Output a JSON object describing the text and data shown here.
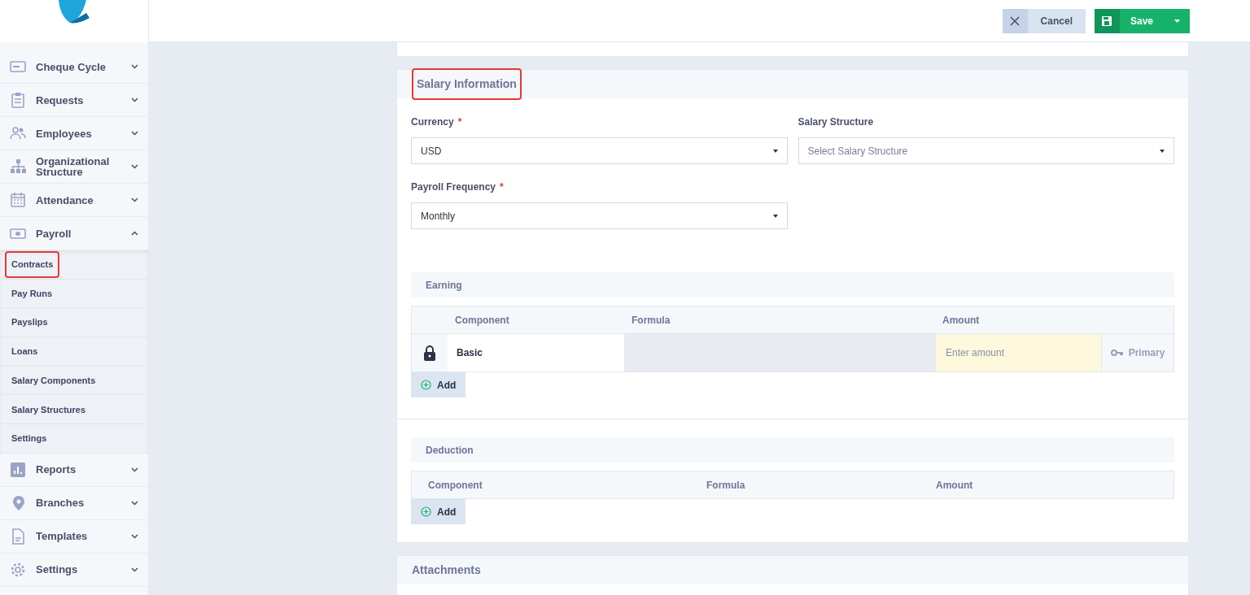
{
  "header": {
    "buttons": [
      {
        "kind": "cancel",
        "label": "Cancel"
      },
      {
        "kind": "save",
        "label": "Save"
      }
    ]
  },
  "sidebar": {
    "items": [
      {
        "label": "Cheque Cycle",
        "expanded": false
      },
      {
        "label": "Requests",
        "expanded": false
      },
      {
        "label": "Employees",
        "expanded": false
      },
      {
        "label": "Organizational Structure",
        "expanded": false
      },
      {
        "label": "Attendance",
        "expanded": false
      },
      {
        "label": "Payroll",
        "expanded": true,
        "children": [
          {
            "label": "Contracts",
            "highlighted": true
          },
          {
            "label": "Pay Runs",
            "highlighted": false
          },
          {
            "label": "Payslips",
            "highlighted": false
          },
          {
            "label": "Loans",
            "highlighted": false
          },
          {
            "label": "Salary Components",
            "highlighted": false
          },
          {
            "label": "Salary Structures",
            "highlighted": false
          },
          {
            "label": "Settings",
            "highlighted": false
          }
        ]
      },
      {
        "label": "Reports",
        "expanded": false
      },
      {
        "label": "Branches",
        "expanded": false
      },
      {
        "label": "Templates",
        "expanded": false
      },
      {
        "label": "Settings",
        "expanded": false
      }
    ]
  },
  "salary_section": {
    "title": "Salary Information",
    "highlighted": true,
    "fields": [
      {
        "label": "Currency",
        "required_mark": "*",
        "value": "USD"
      },
      {
        "label": "Salary Structure",
        "placeholder": "Select Salary Structure"
      },
      {
        "label": "Payroll Frequency",
        "required_mark": "*",
        "value": "Monthly"
      }
    ],
    "earning": {
      "title": "Earning",
      "columns": [
        "Component",
        "Formula",
        "Amount"
      ],
      "rows": [
        {
          "locked": true,
          "component": "Basic",
          "amount_placeholder": "Enter amount",
          "tag": "Primary"
        }
      ],
      "add_label": "Add"
    },
    "deduction": {
      "title": "Deduction",
      "columns": [
        "Component",
        "Formula",
        "Amount"
      ],
      "add_label": "Add"
    }
  },
  "attachments": {
    "title": "Attachments"
  }
}
